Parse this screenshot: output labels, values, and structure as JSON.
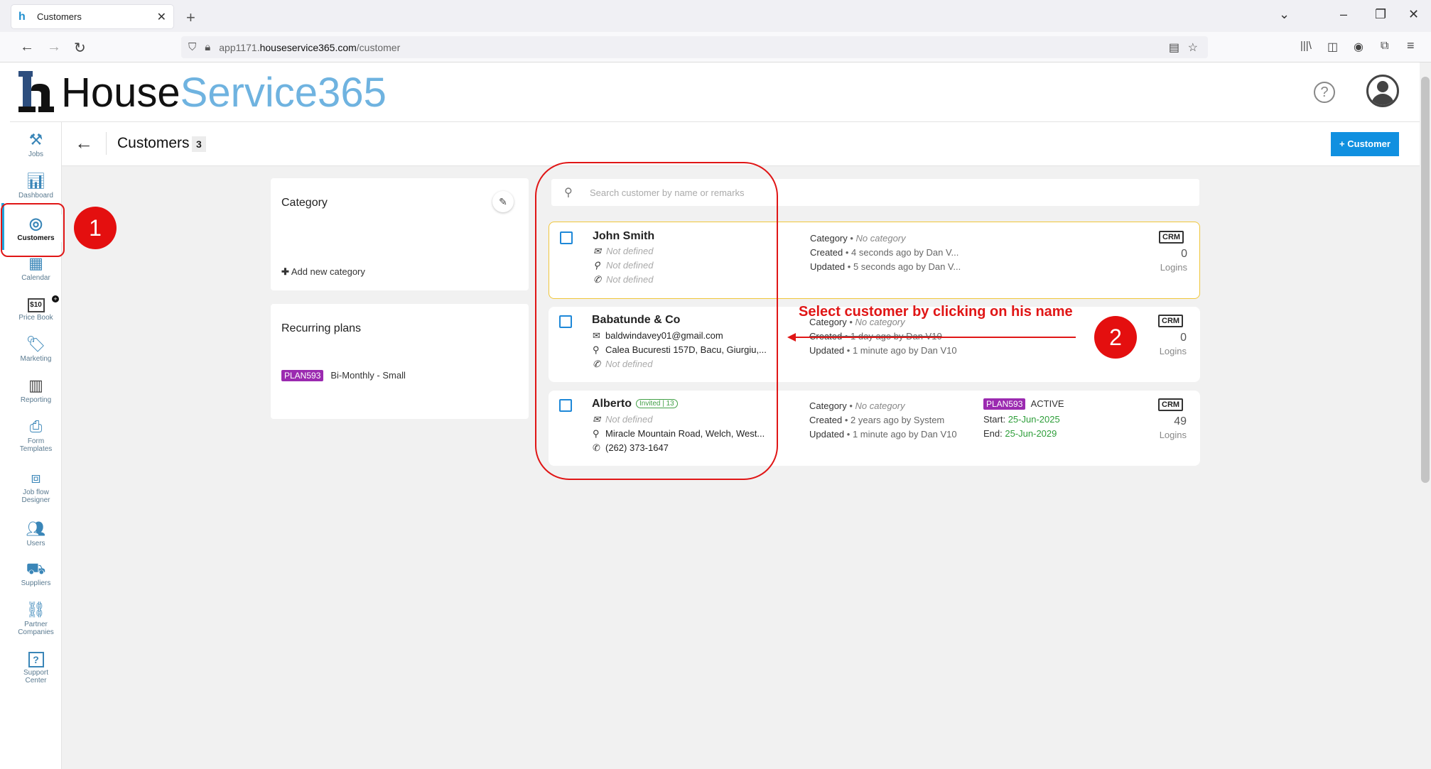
{
  "browser": {
    "tab_title": "Customers",
    "url_prefix": "app1171.",
    "url_host": "houseservice365.com",
    "url_path": "/customer"
  },
  "app": {
    "logo_house": "House",
    "logo_service": "Service365"
  },
  "sidebar": {
    "items": [
      {
        "label": "Jobs",
        "icon": "tools-icon"
      },
      {
        "label": "Dashboard",
        "icon": "chart-icon"
      },
      {
        "label": "Customers",
        "icon": "target-icon"
      },
      {
        "label": "Calendar",
        "icon": "calendar-icon"
      },
      {
        "label": "Price Book",
        "icon": "price-tag-icon",
        "badge": "$10"
      },
      {
        "label": "Marketing",
        "icon": "tag-icon"
      },
      {
        "label": "Reporting",
        "icon": "report-icon"
      },
      {
        "label": "Form Templates",
        "icon": "form-icon"
      },
      {
        "label": "Job flow Designer",
        "icon": "flow-icon"
      },
      {
        "label": "Users",
        "icon": "users-icon"
      },
      {
        "label": "Suppliers",
        "icon": "truck-icon"
      },
      {
        "label": "Partner Companies",
        "icon": "network-icon"
      },
      {
        "label": "Support Center",
        "icon": "question-icon"
      }
    ]
  },
  "page": {
    "title": "Customers",
    "count": "3",
    "add_button": "+ Customer"
  },
  "category_panel": {
    "title": "Category",
    "add_label": "Add new category"
  },
  "recurring_panel": {
    "title": "Recurring plans",
    "plan_code": "PLAN593",
    "plan_name": "Bi-Monthly - Small"
  },
  "search": {
    "placeholder": "Search customer by name or remarks"
  },
  "customers": [
    {
      "name": "John Smith",
      "email": "Not defined",
      "address": "Not defined",
      "phone": "Not defined",
      "category_label": "Category",
      "category": "No category",
      "created_label": "Created",
      "created": "4 seconds ago by Dan V...",
      "updated_label": "Updated",
      "updated": "5 seconds ago by Dan V...",
      "crm": "CRM",
      "logins": "0",
      "logins_label": "Logins"
    },
    {
      "name": "Babatunde & Co",
      "email": "baldwindavey01@gmail.com",
      "address": "Calea Bucuresti 157D, Bacu, Giurgiu,...",
      "phone": "Not defined",
      "category_label": "Category",
      "category": "No category",
      "created_label": "Created",
      "created": "1 day ago by Dan V10",
      "updated_label": "Updated",
      "updated": "1 minute ago by Dan V10",
      "crm": "CRM",
      "logins": "0",
      "logins_label": "Logins"
    },
    {
      "name": "Alberto",
      "invited": "Invited | 13",
      "email": "Not defined",
      "address": "Miracle Mountain Road, Welch, West...",
      "phone": "(262) 373-1647",
      "category_label": "Category",
      "category": "No category",
      "created_label": "Created",
      "created": "2 years ago by System",
      "updated_label": "Updated",
      "updated": "1 minute ago by Dan V10",
      "plan_code": "PLAN593",
      "plan_status": "ACTIVE",
      "start_label": "Start:",
      "start": "25-Jun-2025",
      "end_label": "End:",
      "end": "25-Jun-2029",
      "crm": "CRM",
      "logins": "49",
      "logins_label": "Logins"
    }
  ],
  "annotations": {
    "step1": "1",
    "step2": "2",
    "instruction": "Select customer by clicking on his name",
    "color": "#e01616"
  }
}
